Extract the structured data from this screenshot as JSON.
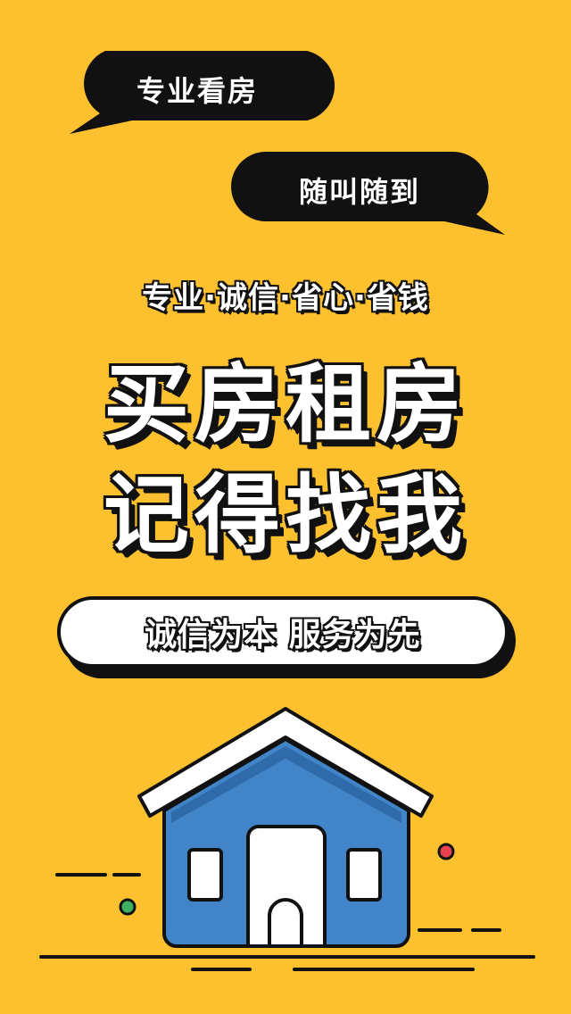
{
  "bubbles": {
    "first": "专业看房",
    "second": "随叫随到"
  },
  "tagline": "专业·诚信·省心·省钱",
  "headline": {
    "line1": "买房租房",
    "line2": "记得找我"
  },
  "slogan": "诚信为本 服务为先",
  "colors": {
    "background": "#FDC02F",
    "bubble": "#111111",
    "house_wall": "#4185C8",
    "roof": "#FFFFFF",
    "outline": "#111111",
    "dot_red": "#E8424E",
    "dot_green": "#3FB061"
  },
  "icons": [
    "speech-bubble-icon",
    "house-icon"
  ]
}
